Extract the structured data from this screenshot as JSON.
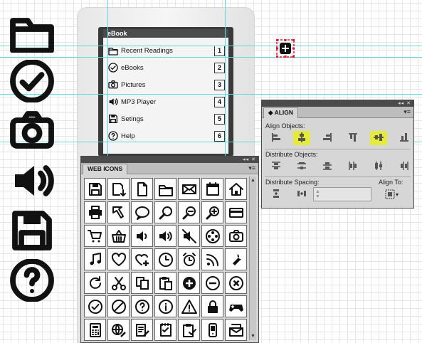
{
  "ebook": {
    "title": "eBook",
    "menu": [
      {
        "label": "Recent Readings",
        "num": "1",
        "icon": "folder-icon"
      },
      {
        "label": "eBooks",
        "num": "2",
        "icon": "check-icon"
      },
      {
        "label": "Pictures",
        "num": "3",
        "icon": "camera-icon"
      },
      {
        "label": "MP3 Player",
        "num": "4",
        "icon": "speaker-icon"
      },
      {
        "label": "Setings",
        "num": "5",
        "icon": "save-icon"
      },
      {
        "label": "Help",
        "num": "6",
        "icon": "help-icon"
      }
    ]
  },
  "big_icons": [
    "folder-icon",
    "check-icon",
    "camera-icon",
    "speaker-icon",
    "save-icon",
    "help-icon"
  ],
  "web_icons_panel": {
    "tab": "WEB ICONS",
    "icons": [
      "save-icon",
      "save-download-icon",
      "document-icon",
      "folder-icon",
      "mail-icon",
      "calendar-icon",
      "home-icon",
      "printer-icon",
      "cursor-icon",
      "speech-bubble-icon",
      "zoom-icon",
      "zoom-out-icon",
      "zoom-in-icon",
      "credit-card-icon",
      "cart-icon",
      "basket-icon",
      "volume-low-icon",
      "volume-high-icon",
      "mute-icon",
      "film-reel-icon",
      "camera-icon",
      "music-note-icon",
      "heart-icon",
      "heart-add-icon",
      "clock-icon",
      "alarm-clock-icon",
      "rss-icon",
      "wrench-icon",
      "refresh-icon",
      "scissors-icon",
      "copy-icon",
      "paste-icon",
      "plus-circle-icon",
      "minus-circle-icon",
      "close-circle-icon",
      "check-circle-icon",
      "block-icon",
      "help-circle-icon",
      "info-circle-icon",
      "warning-icon",
      "lock-icon",
      "gamepad-icon",
      "calculator-icon",
      "globe-edit-icon",
      "notepad-edit-icon",
      "checklist-icon",
      "clipboard-check-icon",
      "mobile-phone-icon",
      "mail-stack-icon"
    ]
  },
  "align_panel": {
    "tab": "ALIGN",
    "align_objects_label": "Align Objects:",
    "distribute_objects_label": "Distribute Objects:",
    "distribute_spacing_label": "Distribute Spacing:",
    "align_to_label": "Align To:",
    "align_objects": [
      {
        "icon": "align-left-icon",
        "highlighted": false
      },
      {
        "icon": "align-horizontal-center-icon",
        "highlighted": true
      },
      {
        "icon": "align-right-icon",
        "highlighted": false
      },
      {
        "icon": "align-top-icon",
        "highlighted": false
      },
      {
        "icon": "align-vertical-center-icon",
        "highlighted": true
      },
      {
        "icon": "align-bottom-icon",
        "highlighted": false
      }
    ],
    "distribute_objects": [
      "distribute-top-icon",
      "distribute-vcenter-icon",
      "distribute-bottom-icon",
      "distribute-left-icon",
      "distribute-hcenter-icon",
      "distribute-right-icon"
    ],
    "distribute_spacing": [
      "distribute-vspace-icon",
      "distribute-hspace-icon"
    ],
    "colors": {
      "highlight": "#e6ea3a",
      "guide": "#5fd9e2",
      "selection": "#e0192a"
    }
  }
}
